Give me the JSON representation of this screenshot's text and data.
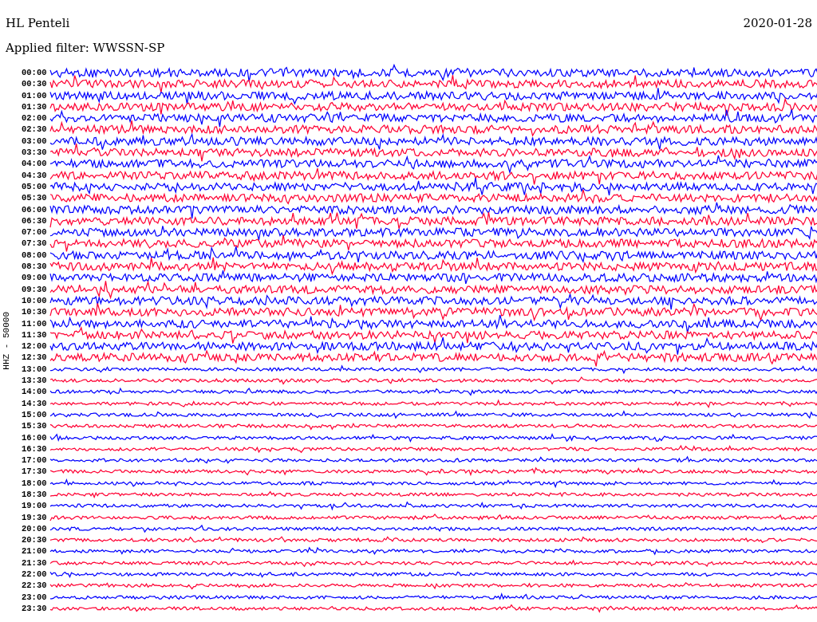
{
  "title": "HL Penteli",
  "date": "2020-01-28",
  "filter": "Applied filter: WWSSN-SP",
  "axis_label": "HHZ - 50000",
  "rows": [
    {
      "time": "00:00",
      "color": "#0000ff"
    },
    {
      "time": "00:30",
      "color": "#ff0033"
    },
    {
      "time": "01:00",
      "color": "#0000ff"
    },
    {
      "time": "01:30",
      "color": "#ff0033"
    },
    {
      "time": "02:00",
      "color": "#0000ff"
    },
    {
      "time": "02:30",
      "color": "#ff0033"
    },
    {
      "time": "03:00",
      "color": "#0000ff"
    },
    {
      "time": "03:30",
      "color": "#ff0033"
    },
    {
      "time": "04:00",
      "color": "#0000ff"
    },
    {
      "time": "04:30",
      "color": "#ff0033"
    },
    {
      "time": "05:00",
      "color": "#0000ff"
    },
    {
      "time": "05:30",
      "color": "#ff0033"
    },
    {
      "time": "06:00",
      "color": "#0000ff"
    },
    {
      "time": "06:30",
      "color": "#ff0033"
    },
    {
      "time": "07:00",
      "color": "#0000ff"
    },
    {
      "time": "07:30",
      "color": "#ff0033"
    },
    {
      "time": "08:00",
      "color": "#0000ff"
    },
    {
      "time": "08:30",
      "color": "#ff0033"
    },
    {
      "time": "09:00",
      "color": "#0000ff"
    },
    {
      "time": "09:30",
      "color": "#ff0033"
    },
    {
      "time": "10:00",
      "color": "#0000ff"
    },
    {
      "time": "10:30",
      "color": "#ff0033"
    },
    {
      "time": "11:00",
      "color": "#0000ff"
    },
    {
      "time": "11:30",
      "color": "#ff0033"
    },
    {
      "time": "12:00",
      "color": "#0000ff"
    },
    {
      "time": "12:30",
      "color": "#ff0033"
    },
    {
      "time": "13:00",
      "color": "#0000ff"
    },
    {
      "time": "13:30",
      "color": "#ff0033"
    },
    {
      "time": "14:00",
      "color": "#0000ff"
    },
    {
      "time": "14:30",
      "color": "#ff0033"
    },
    {
      "time": "15:00",
      "color": "#0000ff"
    },
    {
      "time": "15:30",
      "color": "#ff0033"
    },
    {
      "time": "16:00",
      "color": "#0000ff"
    },
    {
      "time": "16:30",
      "color": "#ff0033"
    },
    {
      "time": "17:00",
      "color": "#0000ff"
    },
    {
      "time": "17:30",
      "color": "#ff0033"
    },
    {
      "time": "18:00",
      "color": "#0000ff"
    },
    {
      "time": "18:30",
      "color": "#ff0033"
    },
    {
      "time": "19:00",
      "color": "#0000ff"
    },
    {
      "time": "19:30",
      "color": "#ff0033"
    },
    {
      "time": "20:00",
      "color": "#0000ff"
    },
    {
      "time": "20:30",
      "color": "#ff0033"
    },
    {
      "time": "21:00",
      "color": "#0000ff"
    },
    {
      "time": "21:30",
      "color": "#ff0033"
    },
    {
      "time": "22:00",
      "color": "#0000ff"
    },
    {
      "time": "22:30",
      "color": "#ff0033"
    },
    {
      "time": "23:00",
      "color": "#0000ff"
    },
    {
      "time": "23:30",
      "color": "#ff0033"
    }
  ]
}
